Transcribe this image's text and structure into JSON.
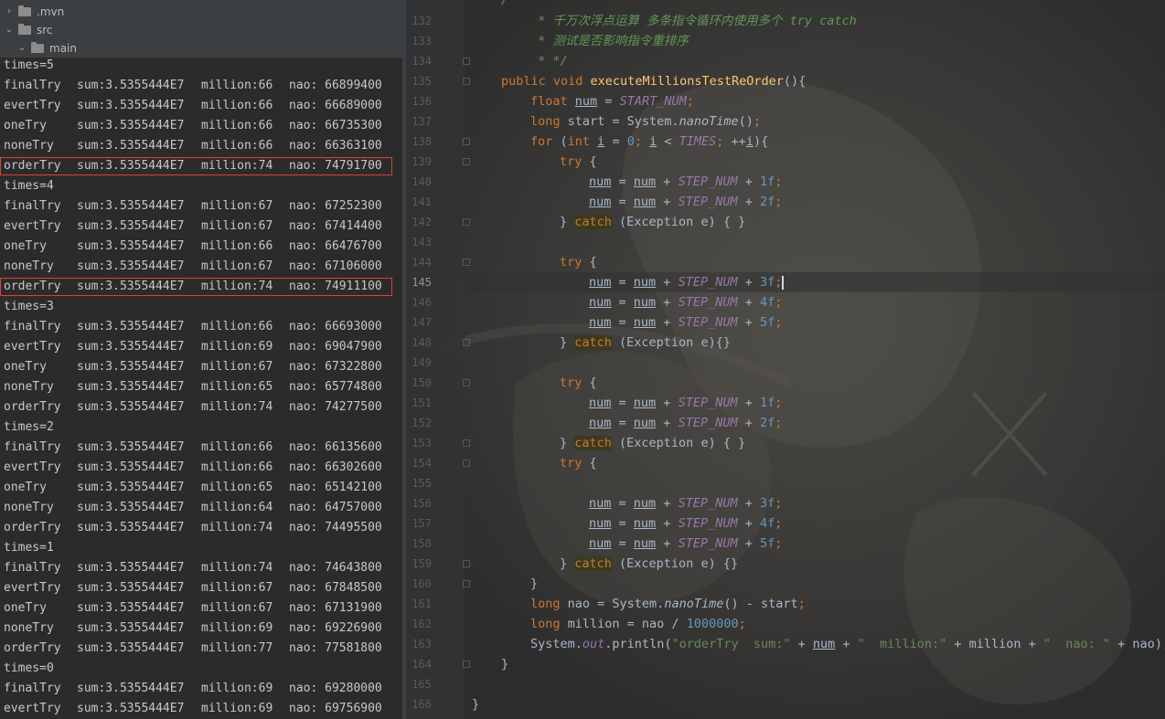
{
  "tree": [
    {
      "label": ".mvn",
      "expanded": false
    },
    {
      "label": "src",
      "expanded": true
    },
    {
      "label": "main",
      "expanded": true
    }
  ],
  "console": [
    {
      "type": "header",
      "text": "times=5"
    },
    {
      "type": "row",
      "name": "finalTry",
      "sum": "sum:3.5355444E7",
      "million": "million:66",
      "nao": "nao: 66899400"
    },
    {
      "type": "row",
      "name": "evertTry",
      "sum": "sum:3.5355444E7",
      "million": "million:66",
      "nao": "nao: 66689000"
    },
    {
      "type": "row",
      "name": "oneTry",
      "sum": "sum:3.5355444E7",
      "million": "million:66",
      "nao": "nao: 66735300"
    },
    {
      "type": "row",
      "name": "noneTry",
      "sum": "sum:3.5355444E7",
      "million": "million:66",
      "nao": "nao: 66363100"
    },
    {
      "type": "row",
      "name": "orderTry",
      "sum": "sum:3.5355444E7",
      "million": "million:74",
      "nao": "nao: 74791700",
      "highlight": true
    },
    {
      "type": "header",
      "text": "times=4"
    },
    {
      "type": "row",
      "name": "finalTry",
      "sum": "sum:3.5355444E7",
      "million": "million:67",
      "nao": "nao: 67252300"
    },
    {
      "type": "row",
      "name": "evertTry",
      "sum": "sum:3.5355444E7",
      "million": "million:67",
      "nao": "nao: 67414400"
    },
    {
      "type": "row",
      "name": "oneTry",
      "sum": "sum:3.5355444E7",
      "million": "million:66",
      "nao": "nao: 66476700"
    },
    {
      "type": "row",
      "name": "noneTry",
      "sum": "sum:3.5355444E7",
      "million": "million:67",
      "nao": "nao: 67106000"
    },
    {
      "type": "row",
      "name": "orderTry",
      "sum": "sum:3.5355444E7",
      "million": "million:74",
      "nao": "nao: 74911100",
      "highlight": true
    },
    {
      "type": "header",
      "text": "times=3"
    },
    {
      "type": "row",
      "name": "finalTry",
      "sum": "sum:3.5355444E7",
      "million": "million:66",
      "nao": "nao: 66693000"
    },
    {
      "type": "row",
      "name": "evertTry",
      "sum": "sum:3.5355444E7",
      "million": "million:69",
      "nao": "nao: 69047900"
    },
    {
      "type": "row",
      "name": "oneTry",
      "sum": "sum:3.5355444E7",
      "million": "million:67",
      "nao": "nao: 67322800"
    },
    {
      "type": "row",
      "name": "noneTry",
      "sum": "sum:3.5355444E7",
      "million": "million:65",
      "nao": "nao: 65774800"
    },
    {
      "type": "row",
      "name": "orderTry",
      "sum": "sum:3.5355444E7",
      "million": "million:74",
      "nao": "nao: 74277500"
    },
    {
      "type": "header",
      "text": "times=2"
    },
    {
      "type": "row",
      "name": "finalTry",
      "sum": "sum:3.5355444E7",
      "million": "million:66",
      "nao": "nao: 66135600"
    },
    {
      "type": "row",
      "name": "evertTry",
      "sum": "sum:3.5355444E7",
      "million": "million:66",
      "nao": "nao: 66302600"
    },
    {
      "type": "row",
      "name": "oneTry",
      "sum": "sum:3.5355444E7",
      "million": "million:65",
      "nao": "nao: 65142100"
    },
    {
      "type": "row",
      "name": "noneTry",
      "sum": "sum:3.5355444E7",
      "million": "million:64",
      "nao": "nao: 64757000"
    },
    {
      "type": "row",
      "name": "orderTry",
      "sum": "sum:3.5355444E7",
      "million": "million:74",
      "nao": "nao: 74495500"
    },
    {
      "type": "header",
      "text": "times=1"
    },
    {
      "type": "row",
      "name": "finalTry",
      "sum": "sum:3.5355444E7",
      "million": "million:74",
      "nao": "nao: 74643800"
    },
    {
      "type": "row",
      "name": "evertTry",
      "sum": "sum:3.5355444E7",
      "million": "million:67",
      "nao": "nao: 67848500"
    },
    {
      "type": "row",
      "name": "oneTry",
      "sum": "sum:3.5355444E7",
      "million": "million:67",
      "nao": "nao: 67131900"
    },
    {
      "type": "row",
      "name": "noneTry",
      "sum": "sum:3.5355444E7",
      "million": "million:69",
      "nao": "nao: 69226900"
    },
    {
      "type": "row",
      "name": "orderTry",
      "sum": "sum:3.5355444E7",
      "million": "million:77",
      "nao": "nao: 77581800"
    },
    {
      "type": "header",
      "text": "times=0"
    },
    {
      "type": "row",
      "name": "finalTry",
      "sum": "sum:3.5355444E7",
      "million": "million:69",
      "nao": "nao: 69280000"
    },
    {
      "type": "row",
      "name": "evertTry",
      "sum": "sum:3.5355444E7",
      "million": "million:69",
      "nao": "nao: 69756900"
    }
  ],
  "editor": {
    "current_line": 145,
    "lines": [
      {
        "n": 132,
        "indent": 2,
        "tokens": [
          [
            "cmt",
            " * 千万次浮点运算 多条指令循环内使用多个 try catch"
          ]
        ]
      },
      {
        "n": 133,
        "indent": 2,
        "tokens": [
          [
            "cmt",
            " * 测试是否影响指令重排序"
          ]
        ]
      },
      {
        "n": 134,
        "indent": 2,
        "tokens": [
          [
            "cmt",
            " * */"
          ]
        ]
      },
      {
        "n": 135,
        "indent": 1,
        "tokens": [
          [
            "kw",
            "public void "
          ],
          [
            "fn",
            "executeMillionsTestReOrder"
          ],
          [
            "",
            "(){"
          ]
        ]
      },
      {
        "n": 136,
        "indent": 2,
        "tokens": [
          [
            "kw",
            "float "
          ],
          [
            "var",
            "num"
          ],
          [
            "",
            " = "
          ],
          [
            "cst",
            "START_NUM"
          ],
          [
            "kw",
            ";"
          ]
        ]
      },
      {
        "n": 137,
        "indent": 2,
        "tokens": [
          [
            "kw",
            "long "
          ],
          [
            "",
            "start = System."
          ],
          [
            "st",
            "nanoTime"
          ],
          [
            "",
            "()"
          ],
          [
            "kw",
            ";"
          ]
        ]
      },
      {
        "n": 138,
        "indent": 2,
        "tokens": [
          [
            "kw",
            "for "
          ],
          [
            "",
            "("
          ],
          [
            "kw",
            "int "
          ],
          [
            "var",
            "i"
          ],
          [
            "",
            " = "
          ],
          [
            "num",
            "0"
          ],
          [
            "kw",
            "; "
          ],
          [
            "var",
            "i"
          ],
          [
            "",
            " < "
          ],
          [
            "cst",
            "TIMES"
          ],
          [
            "kw",
            "; "
          ],
          [
            "",
            "++"
          ],
          [
            "var",
            "i"
          ],
          [
            "",
            "){"
          ]
        ]
      },
      {
        "n": 139,
        "indent": 3,
        "tokens": [
          [
            "kw",
            "try "
          ],
          [
            "",
            "{"
          ]
        ]
      },
      {
        "n": 140,
        "indent": 4,
        "tokens": [
          [
            "var",
            "num"
          ],
          [
            "",
            " = "
          ],
          [
            "var",
            "num"
          ],
          [
            "",
            " + "
          ],
          [
            "cst",
            "STEP_NUM"
          ],
          [
            "",
            " + "
          ],
          [
            "num",
            "1f"
          ],
          [
            "kw",
            ";"
          ]
        ]
      },
      {
        "n": 141,
        "indent": 4,
        "tokens": [
          [
            "var",
            "num"
          ],
          [
            "",
            " = "
          ],
          [
            "var",
            "num"
          ],
          [
            "",
            " + "
          ],
          [
            "cst",
            "STEP_NUM"
          ],
          [
            "",
            " + "
          ],
          [
            "num",
            "2f"
          ],
          [
            "kw",
            ";"
          ]
        ]
      },
      {
        "n": 142,
        "indent": 3,
        "tokens": [
          [
            "",
            "} "
          ],
          [
            "kw catchhl",
            "catch"
          ],
          [
            "",
            " (Exception e) { }"
          ]
        ]
      },
      {
        "n": 143,
        "indent": 0,
        "tokens": []
      },
      {
        "n": 144,
        "indent": 3,
        "tokens": [
          [
            "kw",
            "try "
          ],
          [
            "",
            "{"
          ]
        ]
      },
      {
        "n": 145,
        "indent": 4,
        "tokens": [
          [
            "var",
            "num"
          ],
          [
            "",
            " = "
          ],
          [
            "var",
            "num"
          ],
          [
            "",
            " + "
          ],
          [
            "cst",
            "STEP_NUM"
          ],
          [
            "",
            " + "
          ],
          [
            "num",
            "3f"
          ],
          [
            "kw",
            ";"
          ],
          [
            "caret",
            ""
          ]
        ]
      },
      {
        "n": 146,
        "indent": 4,
        "tokens": [
          [
            "var",
            "num"
          ],
          [
            "",
            " = "
          ],
          [
            "var",
            "num"
          ],
          [
            "",
            " + "
          ],
          [
            "cst",
            "STEP_NUM"
          ],
          [
            "",
            " + "
          ],
          [
            "num",
            "4f"
          ],
          [
            "kw",
            ";"
          ]
        ]
      },
      {
        "n": 147,
        "indent": 4,
        "tokens": [
          [
            "var",
            "num"
          ],
          [
            "",
            " = "
          ],
          [
            "var",
            "num"
          ],
          [
            "",
            " + "
          ],
          [
            "cst",
            "STEP_NUM"
          ],
          [
            "",
            " + "
          ],
          [
            "num",
            "5f"
          ],
          [
            "kw",
            ";"
          ]
        ]
      },
      {
        "n": 148,
        "indent": 3,
        "tokens": [
          [
            "",
            "} "
          ],
          [
            "kw catchhl",
            "catch"
          ],
          [
            "",
            " (Exception e){}"
          ]
        ]
      },
      {
        "n": 149,
        "indent": 0,
        "tokens": []
      },
      {
        "n": 150,
        "indent": 3,
        "tokens": [
          [
            "kw",
            "try "
          ],
          [
            "",
            "{"
          ]
        ]
      },
      {
        "n": 151,
        "indent": 4,
        "tokens": [
          [
            "var",
            "num"
          ],
          [
            "",
            " = "
          ],
          [
            "var",
            "num"
          ],
          [
            "",
            " + "
          ],
          [
            "cst",
            "STEP_NUM"
          ],
          [
            "",
            " + "
          ],
          [
            "num",
            "1f"
          ],
          [
            "kw",
            ";"
          ]
        ]
      },
      {
        "n": 152,
        "indent": 4,
        "tokens": [
          [
            "var",
            "num"
          ],
          [
            "",
            " = "
          ],
          [
            "var",
            "num"
          ],
          [
            "",
            " + "
          ],
          [
            "cst",
            "STEP_NUM"
          ],
          [
            "",
            " + "
          ],
          [
            "num",
            "2f"
          ],
          [
            "kw",
            ";"
          ]
        ]
      },
      {
        "n": 153,
        "indent": 3,
        "tokens": [
          [
            "",
            "} "
          ],
          [
            "kw catchhl",
            "catch"
          ],
          [
            "",
            " (Exception e) { }"
          ]
        ]
      },
      {
        "n": 154,
        "indent": 3,
        "tokens": [
          [
            "kw",
            "try "
          ],
          [
            "",
            "{"
          ]
        ]
      },
      {
        "n": 155,
        "indent": 0,
        "tokens": []
      },
      {
        "n": 156,
        "indent": 4,
        "tokens": [
          [
            "var",
            "num"
          ],
          [
            "",
            " = "
          ],
          [
            "var",
            "num"
          ],
          [
            "",
            " + "
          ],
          [
            "cst",
            "STEP_NUM"
          ],
          [
            "",
            " + "
          ],
          [
            "num",
            "3f"
          ],
          [
            "kw",
            ";"
          ]
        ]
      },
      {
        "n": 157,
        "indent": 4,
        "tokens": [
          [
            "var",
            "num"
          ],
          [
            "",
            " = "
          ],
          [
            "var",
            "num"
          ],
          [
            "",
            " + "
          ],
          [
            "cst",
            "STEP_NUM"
          ],
          [
            "",
            " + "
          ],
          [
            "num",
            "4f"
          ],
          [
            "kw",
            ";"
          ]
        ]
      },
      {
        "n": 158,
        "indent": 4,
        "tokens": [
          [
            "var",
            "num"
          ],
          [
            "",
            " = "
          ],
          [
            "var",
            "num"
          ],
          [
            "",
            " + "
          ],
          [
            "cst",
            "STEP_NUM"
          ],
          [
            "",
            " + "
          ],
          [
            "num",
            "5f"
          ],
          [
            "kw",
            ";"
          ]
        ]
      },
      {
        "n": 159,
        "indent": 3,
        "tokens": [
          [
            "",
            "} "
          ],
          [
            "kw catchhl",
            "catch"
          ],
          [
            "",
            " (Exception e) {}"
          ]
        ]
      },
      {
        "n": 160,
        "indent": 2,
        "tokens": [
          [
            "",
            "}"
          ]
        ]
      },
      {
        "n": 161,
        "indent": 2,
        "tokens": [
          [
            "kw",
            "long "
          ],
          [
            "",
            "nao = System."
          ],
          [
            "st",
            "nanoTime"
          ],
          [
            "",
            "() - start"
          ],
          [
            "kw",
            ";"
          ]
        ]
      },
      {
        "n": 162,
        "indent": 2,
        "tokens": [
          [
            "kw",
            "long "
          ],
          [
            "",
            "million = nao / "
          ],
          [
            "num",
            "1000000"
          ],
          [
            "kw",
            ";"
          ]
        ]
      },
      {
        "n": 163,
        "indent": 2,
        "tokens": [
          [
            "",
            "System."
          ],
          [
            "cst",
            "out"
          ],
          [
            "",
            ".println("
          ],
          [
            "str",
            "\"orderTry  sum:\""
          ],
          [
            "",
            " + "
          ],
          [
            "var",
            "num"
          ],
          [
            "",
            " + "
          ],
          [
            "str",
            "\"  million:\""
          ],
          [
            "",
            " + million + "
          ],
          [
            "str",
            "\"  nao: \""
          ],
          [
            "",
            " + nao)"
          ],
          [
            "kw",
            ";"
          ]
        ]
      },
      {
        "n": 164,
        "indent": 1,
        "tokens": [
          [
            "",
            "}"
          ]
        ]
      },
      {
        "n": 165,
        "indent": 0,
        "tokens": []
      },
      {
        "n": 166,
        "indent": 0,
        "tokens": [
          [
            "",
            "}"
          ]
        ]
      }
    ],
    "first_line_text": "/**"
  },
  "colors": {
    "highlight_box": "#d9413a",
    "keyword": "#cc7832",
    "function": "#ffc66d",
    "constant": "#9876aa",
    "number": "#6897bb",
    "string": "#6a8759",
    "comment": "#629755"
  }
}
